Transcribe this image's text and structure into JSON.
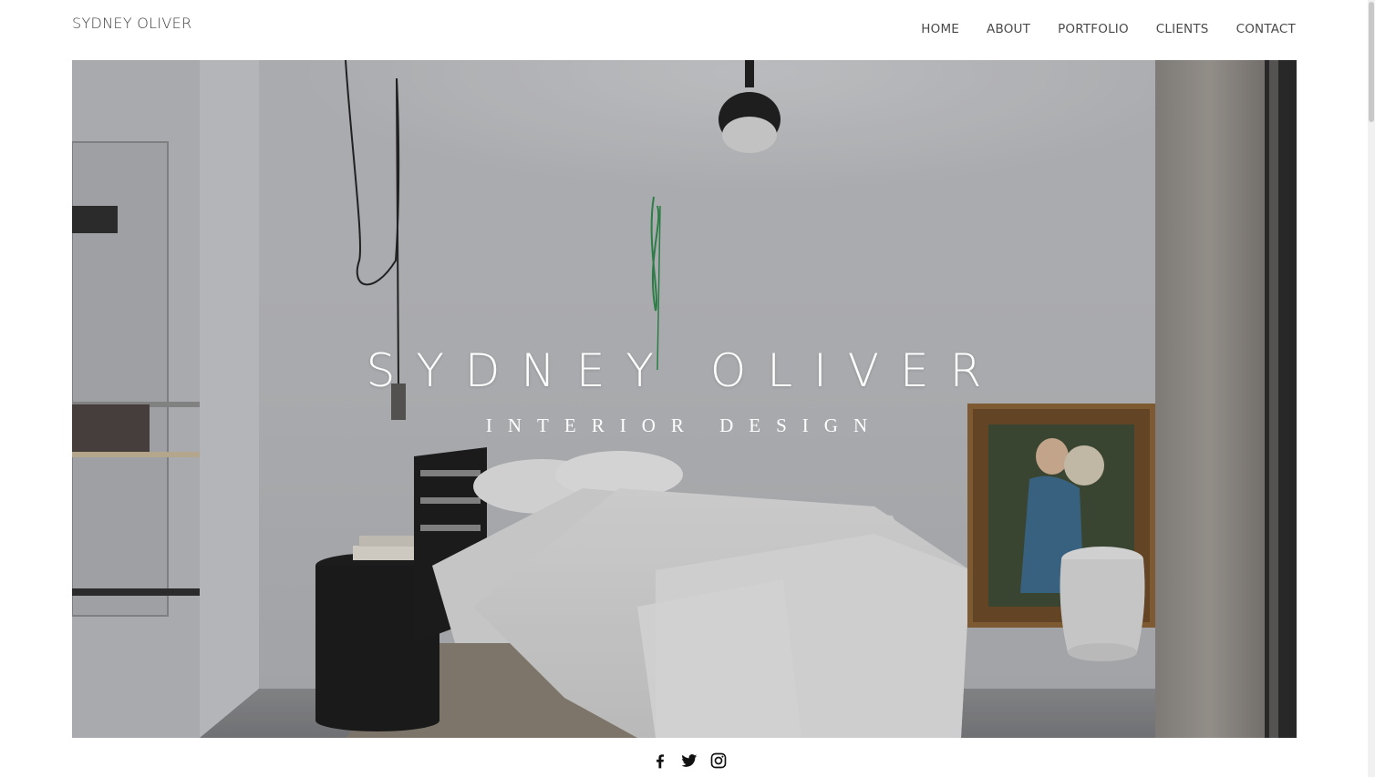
{
  "header": {
    "logo": "SYDNEY OLIVER",
    "nav": [
      {
        "label": "HOME"
      },
      {
        "label": "ABOUT"
      },
      {
        "label": "PORTFOLIO"
      },
      {
        "label": "CLIENTS"
      },
      {
        "label": "CONTACT"
      }
    ]
  },
  "hero": {
    "title": "SYDNEY OLIVER",
    "subtitle": "INTERIOR DESIGN",
    "image_subject": "bedroom-interior-photo"
  },
  "social": [
    {
      "icon": "facebook-icon"
    },
    {
      "icon": "twitter-icon"
    },
    {
      "icon": "instagram-icon"
    }
  ],
  "colors": {
    "text": "#3d3d3d",
    "hero_text": "#ffffff",
    "icon": "#111111"
  }
}
